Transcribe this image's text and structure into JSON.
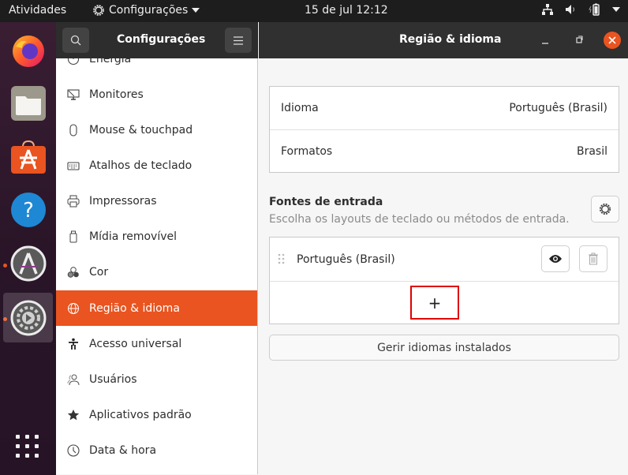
{
  "topbar": {
    "activities": "Atividades",
    "app_menu": "Configurações",
    "clock": "15 de jul  12:12",
    "tray_icons": [
      "network-icon",
      "volume-icon",
      "battery-icon",
      "system-menu-arrow-icon"
    ]
  },
  "dock": {
    "items": [
      {
        "name": "Firefox",
        "icon": "firefox-icon",
        "running": false
      },
      {
        "name": "Arquivos",
        "icon": "files-icon",
        "running": false
      },
      {
        "name": "Ubuntu Software",
        "icon": "software-center-icon",
        "running": false
      },
      {
        "name": "Ajuda",
        "icon": "help-icon",
        "running": false
      },
      {
        "name": "Atualizador",
        "icon": "software-updater-icon",
        "running": true
      },
      {
        "name": "Configurações",
        "icon": "settings-icon",
        "running": true,
        "active": true
      }
    ],
    "show_apps_icon": "app-grid-icon"
  },
  "window": {
    "sidebar_title": "Configurações",
    "page_title": "Região & idioma",
    "accent": "#e95420"
  },
  "sidebar": {
    "items": [
      {
        "label": "Energia",
        "icon": "power-icon"
      },
      {
        "label": "Monitores",
        "icon": "display-icon"
      },
      {
        "label": "Mouse & touchpad",
        "icon": "mouse-icon"
      },
      {
        "label": "Atalhos de teclado",
        "icon": "keyboard-icon"
      },
      {
        "label": "Impressoras",
        "icon": "printer-icon"
      },
      {
        "label": "Mídia removível",
        "icon": "usb-icon"
      },
      {
        "label": "Cor",
        "icon": "color-icon"
      },
      {
        "label": "Região & idioma",
        "icon": "globe-icon",
        "selected": true
      },
      {
        "label": "Acesso universal",
        "icon": "accessibility-icon"
      },
      {
        "label": "Usuários",
        "icon": "users-icon"
      },
      {
        "label": "Aplicativos padrão",
        "icon": "star-icon"
      },
      {
        "label": "Data & hora",
        "icon": "clock-icon"
      }
    ]
  },
  "region": {
    "language_label": "Idioma",
    "language_value": "Português (Brasil)",
    "formats_label": "Formatos",
    "formats_value": "Brasil"
  },
  "input_sources": {
    "title": "Fontes de entrada",
    "subtitle": "Escolha os layouts de teclado ou métodos de entrada.",
    "sources": [
      {
        "label": "Português (Brasil)"
      }
    ],
    "add_label": "+",
    "manage_button": "Gerir idiomas instalados"
  }
}
